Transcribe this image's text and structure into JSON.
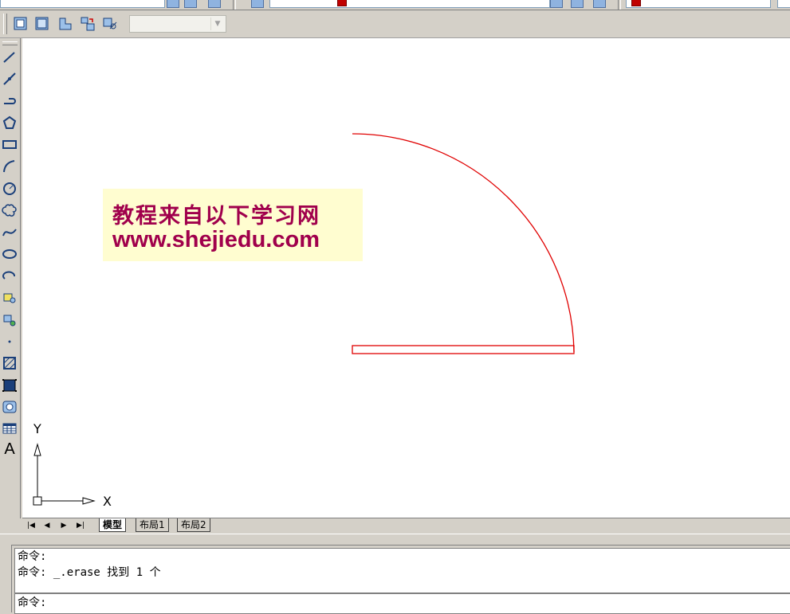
{
  "toolbar2": {
    "buttons": [
      "viewport-1-icon",
      "viewport-single-icon",
      "viewport-clip-icon",
      "viewport-tile-icon",
      "viewport-properties-icon"
    ],
    "scale_combo_value": ""
  },
  "draw_toolbar": {
    "tools": [
      "line-icon",
      "construction-line-icon",
      "polyline-icon",
      "polygon-icon",
      "rectangle-icon",
      "arc-icon",
      "circle-icon",
      "revision-cloud-icon",
      "spline-icon",
      "ellipse-icon",
      "ellipse-arc-icon",
      "insert-block-icon",
      "make-block-icon",
      "point-icon",
      "hatch-icon",
      "gradient-icon",
      "region-icon",
      "table-icon",
      "multiline-text-icon"
    ],
    "text_tool_glyph": "A"
  },
  "watermark": {
    "line1": "教程来自以下学习网",
    "line2": "www.shejiedu.com"
  },
  "ucs": {
    "x_label": "X",
    "y_label": "Y"
  },
  "drawing": {
    "stroke_color": "#e00000"
  },
  "layout_tabs": {
    "tabs": [
      {
        "label": "模型",
        "active": true
      },
      {
        "label": "布局1",
        "active": false
      },
      {
        "label": "布局2",
        "active": false
      }
    ]
  },
  "command": {
    "history": [
      "命令:",
      "命令: _.erase 找到 1 个"
    ],
    "prompt": "命令:"
  },
  "colors": {
    "canvas": "#ffffff",
    "chrome": "#d4d0c8",
    "watermark_text": "#a0004c",
    "watermark_bg": "#fffdd0"
  }
}
